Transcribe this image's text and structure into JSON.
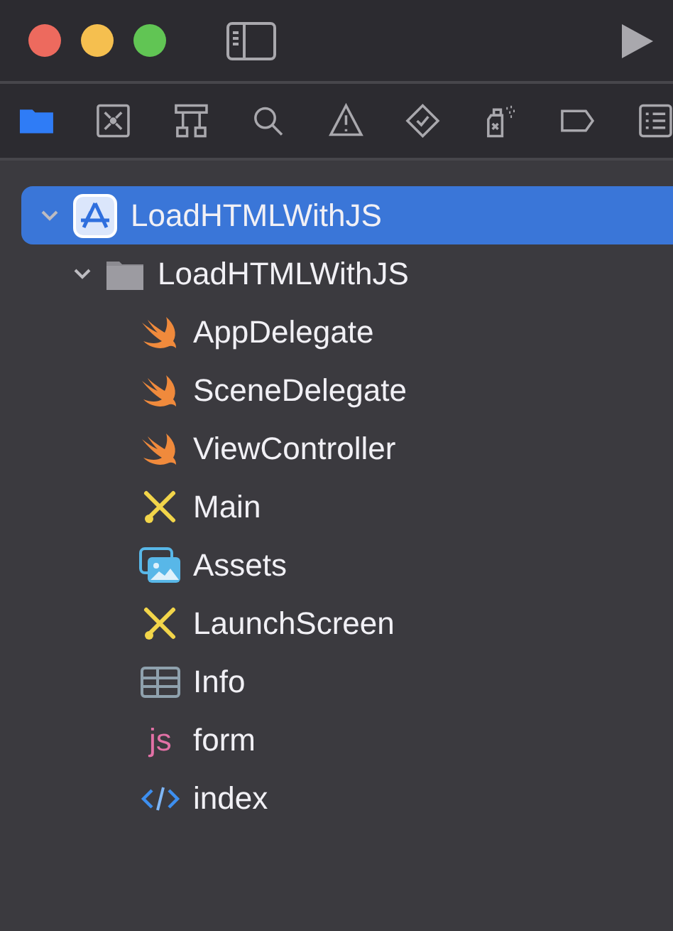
{
  "window": {
    "controls": [
      {
        "color": "#ed6a5e"
      },
      {
        "color": "#f5bf4f"
      },
      {
        "color": "#61c554"
      }
    ]
  },
  "navigator_tabs": [
    {
      "kind": "project",
      "selected": true
    },
    {
      "kind": "source-control",
      "selected": false
    },
    {
      "kind": "symbol",
      "selected": false
    },
    {
      "kind": "find",
      "selected": false
    },
    {
      "kind": "issue",
      "selected": false
    },
    {
      "kind": "test",
      "selected": false
    },
    {
      "kind": "debug",
      "selected": false
    },
    {
      "kind": "breakpoint",
      "selected": false
    },
    {
      "kind": "report",
      "selected": false
    }
  ],
  "tree": [
    {
      "kind": "project",
      "name": "LoadHTMLWithJS",
      "selected": true,
      "expanded": true,
      "children": [
        {
          "kind": "folder",
          "name": "LoadHTMLWithJS",
          "selected": false,
          "expanded": true,
          "children": [
            {
              "kind": "swift",
              "name": "AppDelegate",
              "selected": false
            },
            {
              "kind": "swift",
              "name": "SceneDelegate",
              "selected": false
            },
            {
              "kind": "swift",
              "name": "ViewController",
              "selected": false
            },
            {
              "kind": "storyboard",
              "name": "Main",
              "selected": false
            },
            {
              "kind": "assets",
              "name": "Assets",
              "selected": false
            },
            {
              "kind": "storyboard",
              "name": "LaunchScreen",
              "selected": false
            },
            {
              "kind": "plist",
              "name": "Info",
              "selected": false
            },
            {
              "kind": "js",
              "name": "form",
              "icon_text": "js",
              "selected": false
            },
            {
              "kind": "html",
              "name": "index",
              "selected": false
            }
          ]
        }
      ]
    }
  ]
}
